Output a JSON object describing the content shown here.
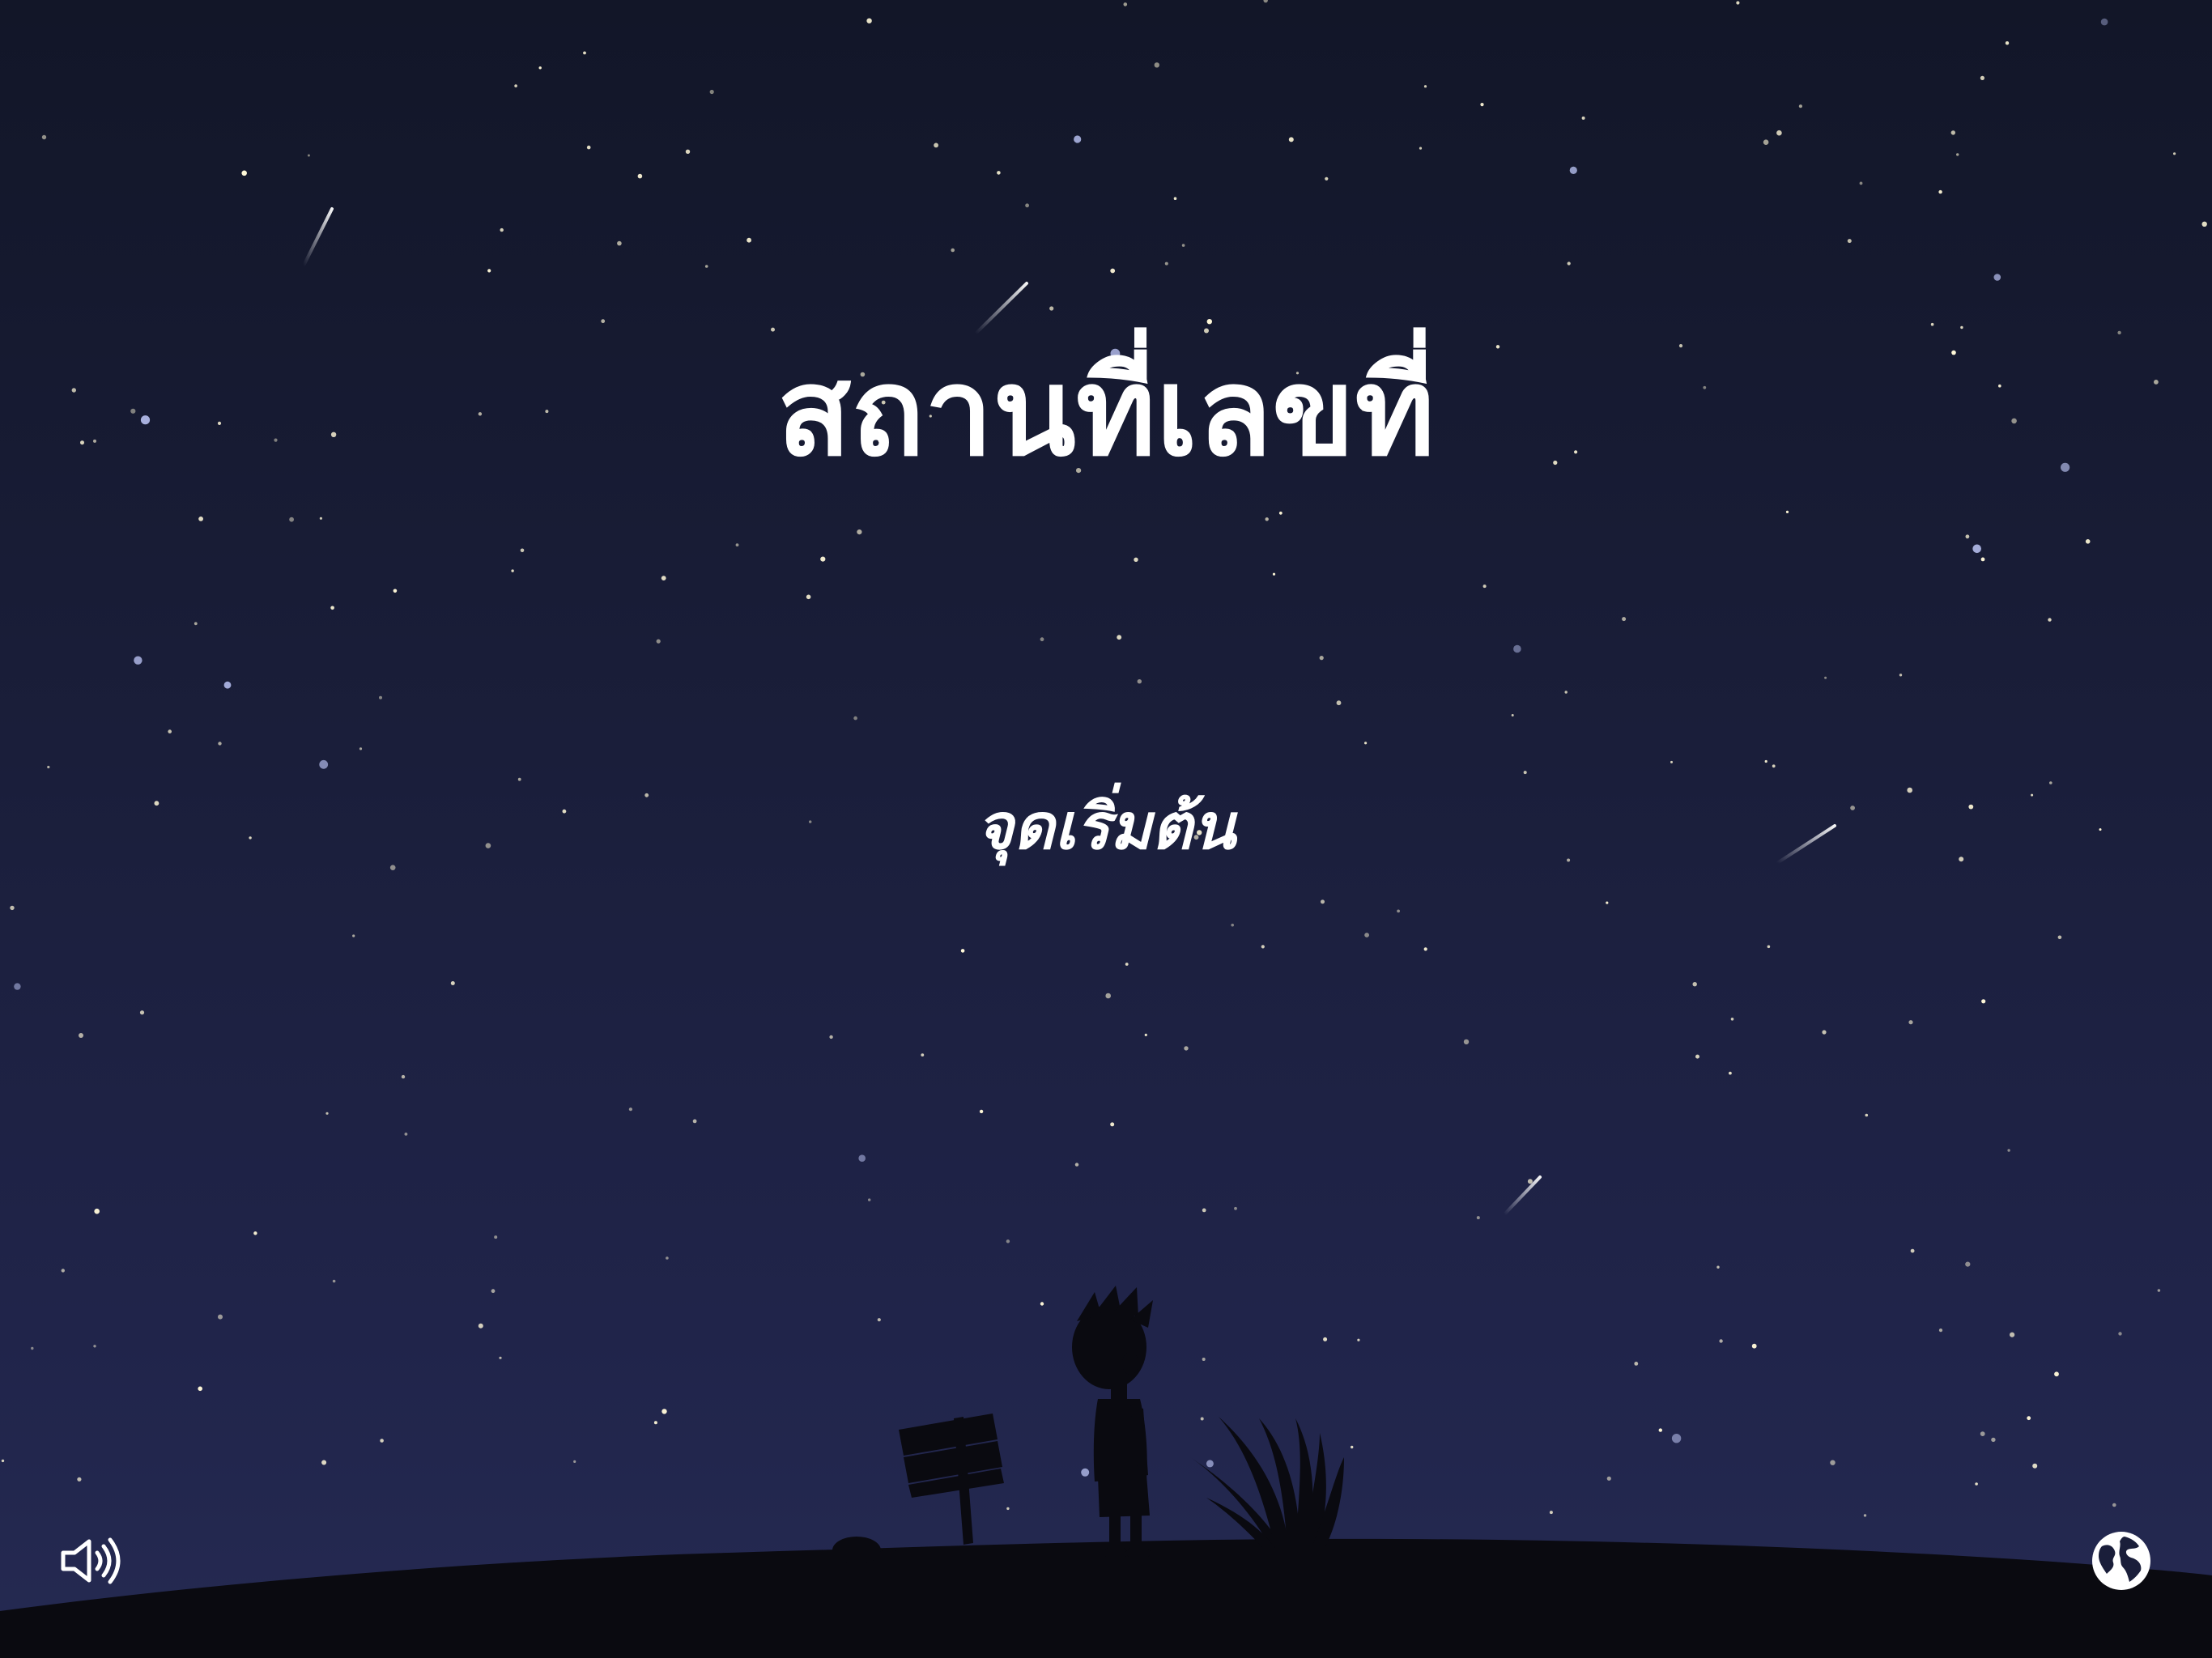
{
  "title": "สถานที่เลขที่",
  "start_label": "จุดเริ่มต้น",
  "controls": {
    "sound_icon": "speaker-icon",
    "language_icon": "globe-icon"
  },
  "colors": {
    "sky_top": "#121628",
    "sky_bottom": "#252a52",
    "ground": "#0a0a10",
    "text": "#ffffff",
    "star": "#fff8d8"
  }
}
